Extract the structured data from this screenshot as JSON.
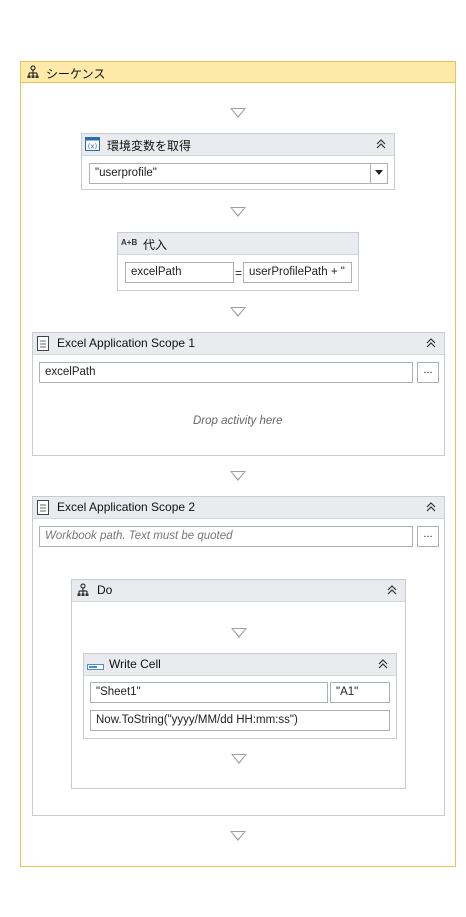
{
  "sequence": {
    "title": "シーケンス"
  },
  "get_env": {
    "title": "環境変数を取得",
    "value": "\"userprofile\""
  },
  "assign": {
    "badge": "A+B",
    "title": "代入",
    "to": "excelPath",
    "equals": "=",
    "value": "userProfilePath + \""
  },
  "scope1": {
    "title": "Excel Application Scope 1",
    "path": "excelPath",
    "dots": "...",
    "drop_text": "Drop activity here"
  },
  "scope2": {
    "title": "Excel Application Scope 2",
    "path_placeholder": "Workbook path. Text must be quoted",
    "dots": "...",
    "do": {
      "title": "Do",
      "write_cell": {
        "title": "Write Cell",
        "sheet": "\"Sheet1\"",
        "range": "\"A1\"",
        "value": "Now.ToString(\"yyyy/MM/dd HH:mm:ss\")"
      }
    }
  }
}
